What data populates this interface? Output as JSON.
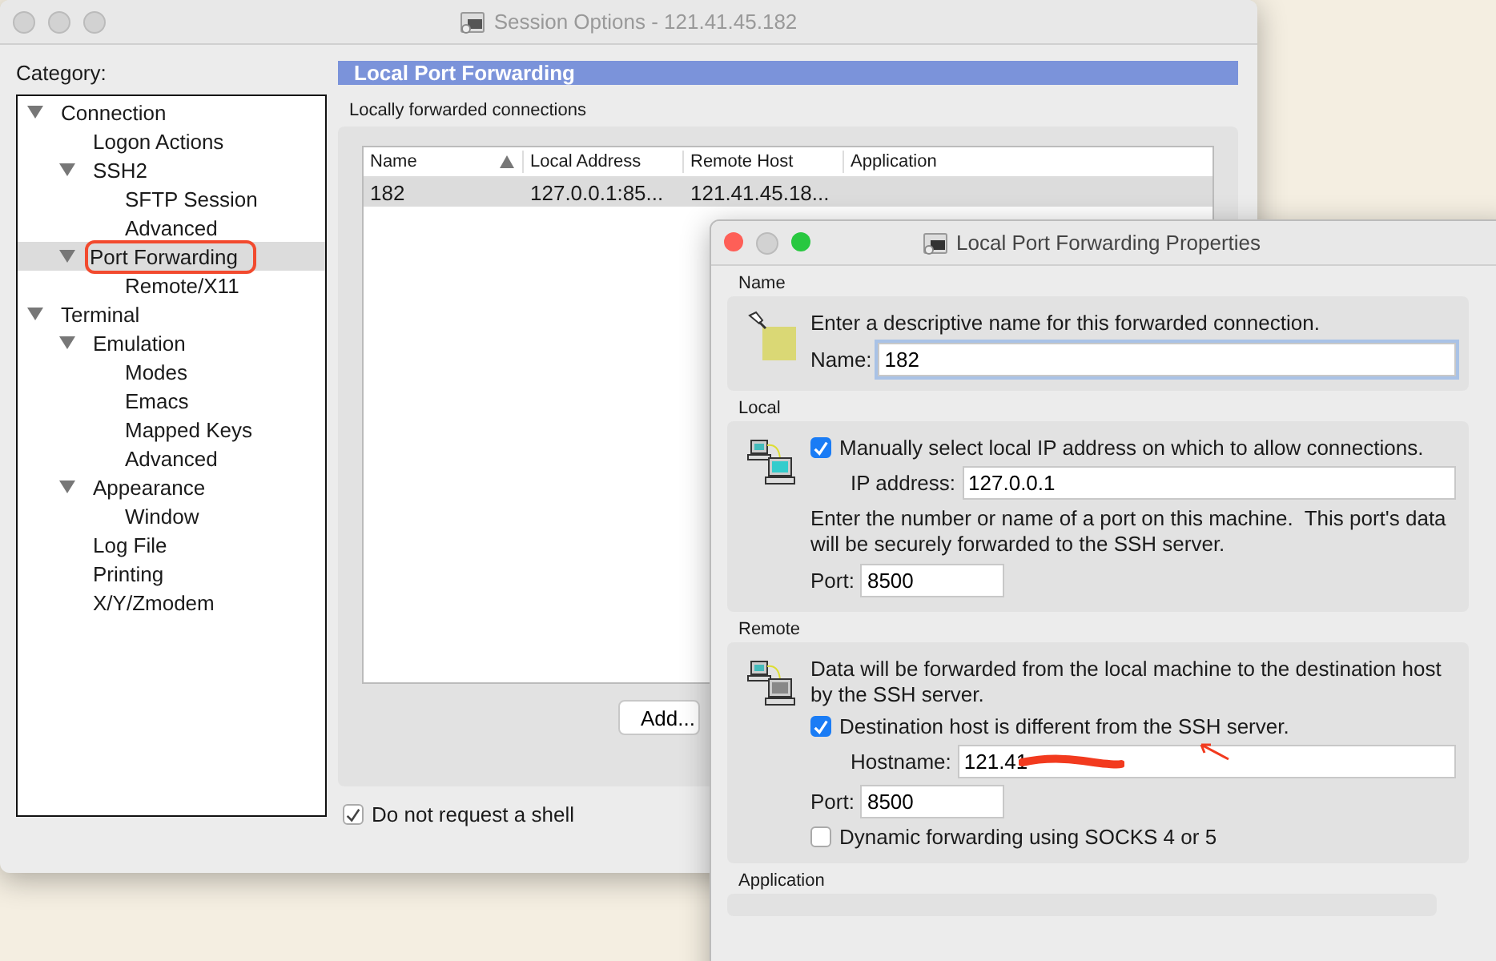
{
  "main_window": {
    "title": "Session Options - 121.41.45.182",
    "category_label": "Category:",
    "tree": [
      {
        "label": "Connection",
        "expanded": true,
        "selected": false,
        "highlighted": false,
        "children": [
          {
            "label": "Logon Actions",
            "selected": false,
            "highlighted": false
          },
          {
            "label": "SSH2",
            "expanded": true,
            "selected": false,
            "highlighted": false,
            "children": [
              {
                "label": "SFTP Session",
                "selected": false,
                "highlighted": false
              },
              {
                "label": "Advanced",
                "selected": false,
                "highlighted": false
              }
            ]
          },
          {
            "label": "Port Forwarding",
            "expanded": true,
            "selected": true,
            "highlighted": true,
            "children": [
              {
                "label": "Remote/X11",
                "selected": false,
                "highlighted": false
              }
            ]
          }
        ]
      },
      {
        "label": "Terminal",
        "expanded": true,
        "selected": false,
        "highlighted": false,
        "children": [
          {
            "label": "Emulation",
            "expanded": true,
            "selected": false,
            "highlighted": false,
            "children": [
              {
                "label": "Modes",
                "selected": false,
                "highlighted": false
              },
              {
                "label": "Emacs",
                "selected": false,
                "highlighted": false
              },
              {
                "label": "Mapped Keys",
                "selected": false,
                "highlighted": false
              },
              {
                "label": "Advanced",
                "selected": false,
                "highlighted": false
              }
            ]
          },
          {
            "label": "Appearance",
            "expanded": true,
            "selected": false,
            "highlighted": false,
            "children": [
              {
                "label": "Window",
                "selected": false,
                "highlighted": false
              }
            ]
          },
          {
            "label": "Log File",
            "selected": false,
            "highlighted": false
          },
          {
            "label": "Printing",
            "selected": false,
            "highlighted": false
          },
          {
            "label": "X/Y/Zmodem",
            "selected": false,
            "highlighted": false
          }
        ]
      }
    ],
    "panel_title": "Local Port Forwarding",
    "list_label": "Locally forwarded connections",
    "table": {
      "columns": [
        {
          "label": "Name",
          "sorted": true
        },
        {
          "label": "Local Address",
          "sorted": false
        },
        {
          "label": "Remote Host",
          "sorted": false
        },
        {
          "label": "Application",
          "sorted": false
        }
      ],
      "rows": [
        {
          "cells": [
            "182",
            "127.0.0.1:85...",
            "121.41.45.18..."
          ],
          "selected": true
        }
      ]
    },
    "add_button": "Add...",
    "no_shell": {
      "label": "Do not request a shell",
      "checked": true
    }
  },
  "dialog": {
    "title": "Local Port Forwarding Properties",
    "name_section": {
      "label": "Name",
      "hint": "Enter a descriptive name for this forwarded connection.",
      "field_label": "Name:",
      "value": "182"
    },
    "local_section": {
      "label": "Local",
      "manual_ip": {
        "label": "Manually select local IP address on which to allow connections.",
        "checked": true
      },
      "ip_label": "IP address:",
      "ip_value": "127.0.0.1",
      "hint": "Enter the number or name of a port on this machine.  This port's data will be securely forwarded to the SSH server.",
      "port_label": "Port:",
      "port_value": "8500"
    },
    "remote_section": {
      "label": "Remote",
      "hint": "Data will be forwarded from the local machine to the destination host by the SSH server.",
      "different_host": {
        "label": "Destination host is different from the SSH server.",
        "checked": true
      },
      "hostname_label": "Hostname:",
      "hostname_value": "121.41",
      "port_label": "Port:",
      "port_value": "8500",
      "dynamic": {
        "label": "Dynamic forwarding using SOCKS 4 or 5",
        "checked": false
      }
    },
    "application_section": {
      "label": "Application"
    }
  }
}
